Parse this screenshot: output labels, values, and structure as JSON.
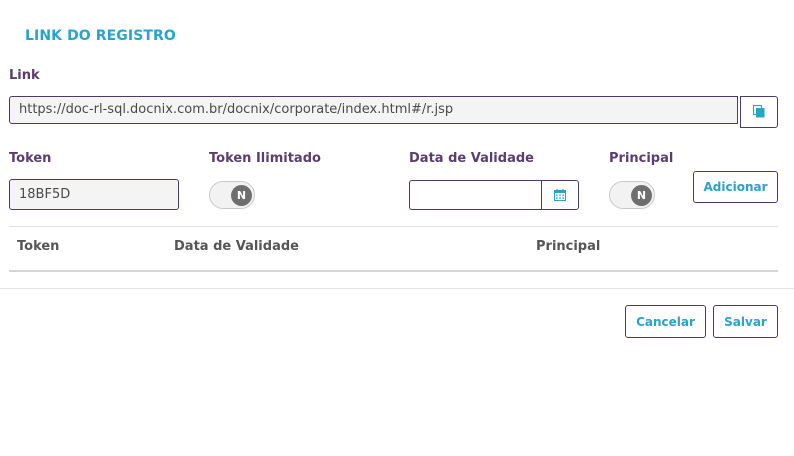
{
  "header": {
    "title": "LINK DO REGISTRO"
  },
  "link": {
    "label": "Link",
    "value": "https://doc-rl-sql.docnix.com.br/docnix/corporate/index.html#/r.jsp",
    "copy_icon": "copy-icon"
  },
  "form": {
    "token_label": "Token",
    "token_value": "18BF5D",
    "token_ilimitado_label": "Token Ilimitado",
    "token_ilimitado_toggle": "N",
    "data_validade_label": "Data de Validade",
    "data_validade_value": "",
    "calendar_icon": "calendar-icon",
    "principal_label": "Principal",
    "principal_toggle": "N",
    "add_button": "Adicionar"
  },
  "table": {
    "columns": [
      "Token",
      "Data de Validade",
      "Principal"
    ],
    "rows": []
  },
  "footer": {
    "cancel_button": "Cancelar",
    "save_button": "Salvar"
  },
  "colors": {
    "accent": "#29a3c9",
    "label": "#5a3e6e",
    "border": "#4b3b6b"
  }
}
